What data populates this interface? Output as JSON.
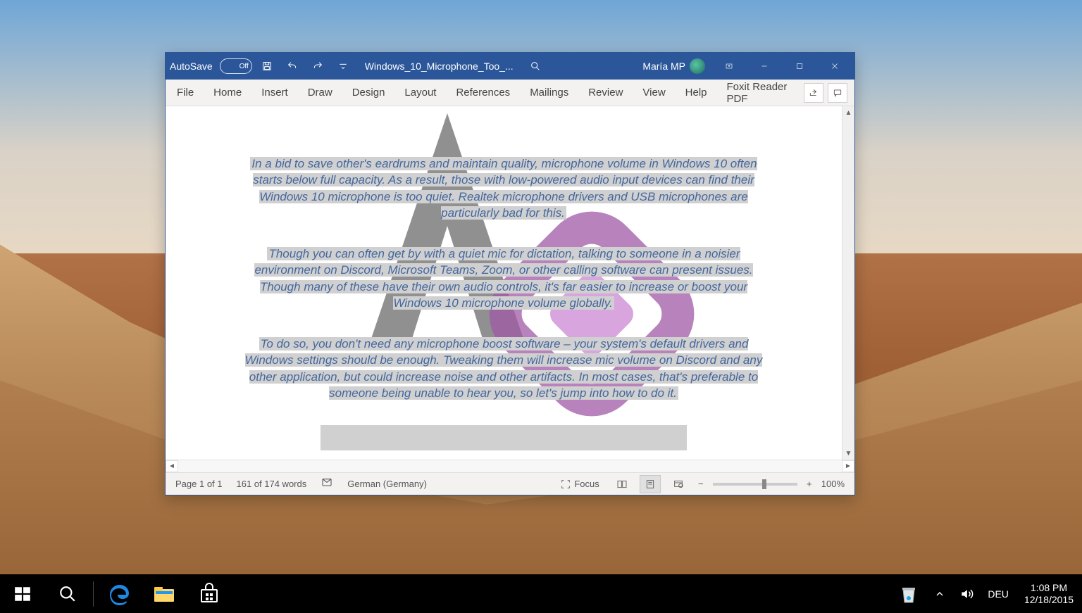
{
  "titlebar": {
    "autosave_label": "AutoSave",
    "autosave_state": "Off",
    "doc_title": "Windows_10_Microphone_Too_...",
    "user_name": "María MP"
  },
  "ribbon": {
    "tabs": [
      "File",
      "Home",
      "Insert",
      "Draw",
      "Design",
      "Layout",
      "References",
      "Mailings",
      "Review",
      "View",
      "Help",
      "Foxit Reader PDF"
    ]
  },
  "document": {
    "para1": "In a bid to save other's eardrums and maintain quality, microphone volume in Windows 10 often starts below full capacity. As a result, those with low-powered audio input devices can find their Windows 10 microphone is too quiet. Realtek microphone drivers and USB microphones are particularly bad for this.",
    "para2": "Though you can often get by with a quiet mic for dictation, talking to someone in a noisier environment on Discord, Microsoft Teams, Zoom, or other calling software can present issues. Though many of these have their own audio controls, it's far easier to increase or boost your Windows 10 microphone volume globally.",
    "para3": "To do so, you don't need any microphone boost software – your system's default drivers and Windows settings should be enough. Tweaking them will increase mic volume on Discord and any other application, but could increase noise and other artifacts. In most cases, that's preferable to someone being unable to hear you, so let's jump into how to do it."
  },
  "statusbar": {
    "page": "Page 1 of 1",
    "words": "161 of 174 words",
    "language": "German (Germany)",
    "focus": "Focus",
    "zoom": "100%"
  },
  "taskbar": {
    "ime": "DEU",
    "time": "1:08 PM",
    "date": "12/18/2015"
  }
}
